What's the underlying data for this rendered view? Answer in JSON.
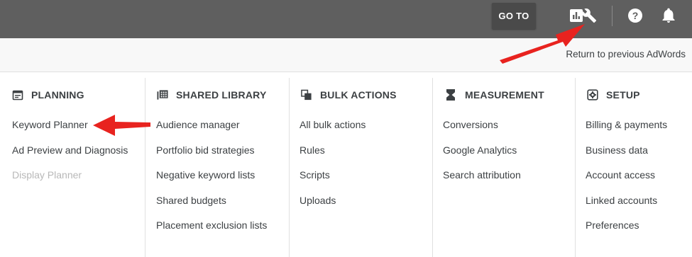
{
  "topbar": {
    "goto_label": "GO TO",
    "icons": [
      "reports-icon",
      "tools-wrench-icon",
      "help-icon",
      "notifications-bell-icon"
    ]
  },
  "subbar": {
    "return_label": "Return to previous AdWords"
  },
  "menu": {
    "columns": [
      {
        "title": "PLANNING",
        "icon": "calendar-icon",
        "items": [
          "Keyword Planner",
          "Ad Preview and Diagnosis",
          "Display Planner"
        ]
      },
      {
        "title": "SHARED LIBRARY",
        "icon": "library-icon",
        "items": [
          "Audience manager",
          "Portfolio bid strategies",
          "Negative keyword lists",
          "Shared budgets",
          "Placement exclusion lists"
        ]
      },
      {
        "title": "BULK ACTIONS",
        "icon": "copy-stack-icon",
        "items": [
          "All bulk actions",
          "Rules",
          "Scripts",
          "Uploads"
        ]
      },
      {
        "title": "MEASUREMENT",
        "icon": "hourglass-icon",
        "items": [
          "Conversions",
          "Google Analytics",
          "Search attribution"
        ]
      },
      {
        "title": "SETUP",
        "icon": "settings-gear-icon",
        "items": [
          "Billing & payments",
          "Business data",
          "Account access",
          "Linked accounts",
          "Preferences"
        ]
      }
    ]
  },
  "colors": {
    "topbar_bg": "#5f5f5f",
    "goto_bg": "#4a4a4a",
    "arrow": "#e8231f",
    "disabled_text": "#b8b8b8"
  }
}
